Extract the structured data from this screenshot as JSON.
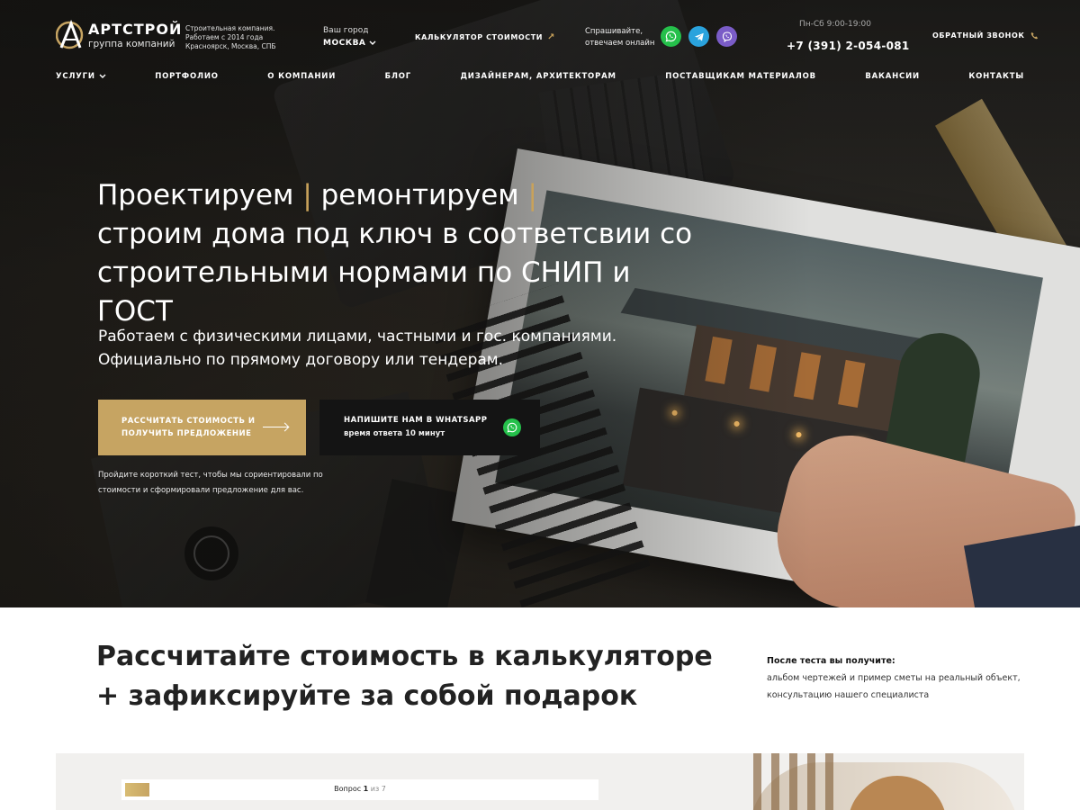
{
  "header": {
    "logo": {
      "name": "АРТСТРОЙ",
      "sub": "группа компаний"
    },
    "company": "Строительная компания. Работаем с 2014 года Красноярск, Москва, СПБ",
    "city_label": "Ваш город",
    "city_value": "МОСКВА",
    "calc_link": "КАЛЬКУЛЯТОР СТОИМОСТИ",
    "ask": [
      "Спрашивайте,",
      "отвечаем онлайн"
    ],
    "messengers": [
      "whatsapp-icon",
      "telegram-icon",
      "viber-icon"
    ],
    "hours": "Пн-Сб 9:00-19:00",
    "phone": "+7 (391) 2-054-081",
    "callback": "ОБРАТНЫЙ ЗВОНОК"
  },
  "nav": [
    "УСЛУГИ",
    "ПОРТФОЛИО",
    "О КОМПАНИИ",
    "БЛОГ",
    "ДИЗАЙНЕРАМ, АРХИТЕКТОРАМ",
    "ПОСТАВЩИКАМ МАТЕРИАЛОВ",
    "ВАКАНСИИ",
    "КОНТАКТЫ"
  ],
  "hero": {
    "title_w1": "Проектируем",
    "title_w2": "ремонтируем",
    "title_rest": "строим дома под ключ в соответсвии со строительными нормами по СНИП и ГОСТ",
    "sub": "Работаем с физическими лицами, частными и гос. компаниями. Официально по прямому договору или тендерам.",
    "btn_calc": "РАССЧИТАТЬ СТОИМОСТЬ И ПОЛУЧИТЬ ПРЕДЛОЖЕНИЕ",
    "btn_wa_title": "НАПИШИТЕ НАМ В WHATSAPP",
    "btn_wa_sub": "время ответа 10 минут",
    "hint": "Пройдите короткий тест, чтобы мы сориентировали по стоимости и сформировали предложение для вас."
  },
  "calc": {
    "title_bold": "Рассчитайте стоимость",
    "title_rest": "в калькуляторе + зафиксируйте за собой подарок",
    "after_head": "После теста вы получите:",
    "after_text": "альбом чертежей и пример сметы на реальный объект, консультацию нашего специалиста",
    "question_label": "Вопрос",
    "question_current": "1",
    "question_of": "из",
    "question_total": "7",
    "progress": 0.14
  },
  "colors": {
    "gold": "#c6a462",
    "dark_button": "#141414",
    "whatsapp": "#25c04b",
    "telegram": "#2aa3dd",
    "viber": "#7a5cc7"
  }
}
